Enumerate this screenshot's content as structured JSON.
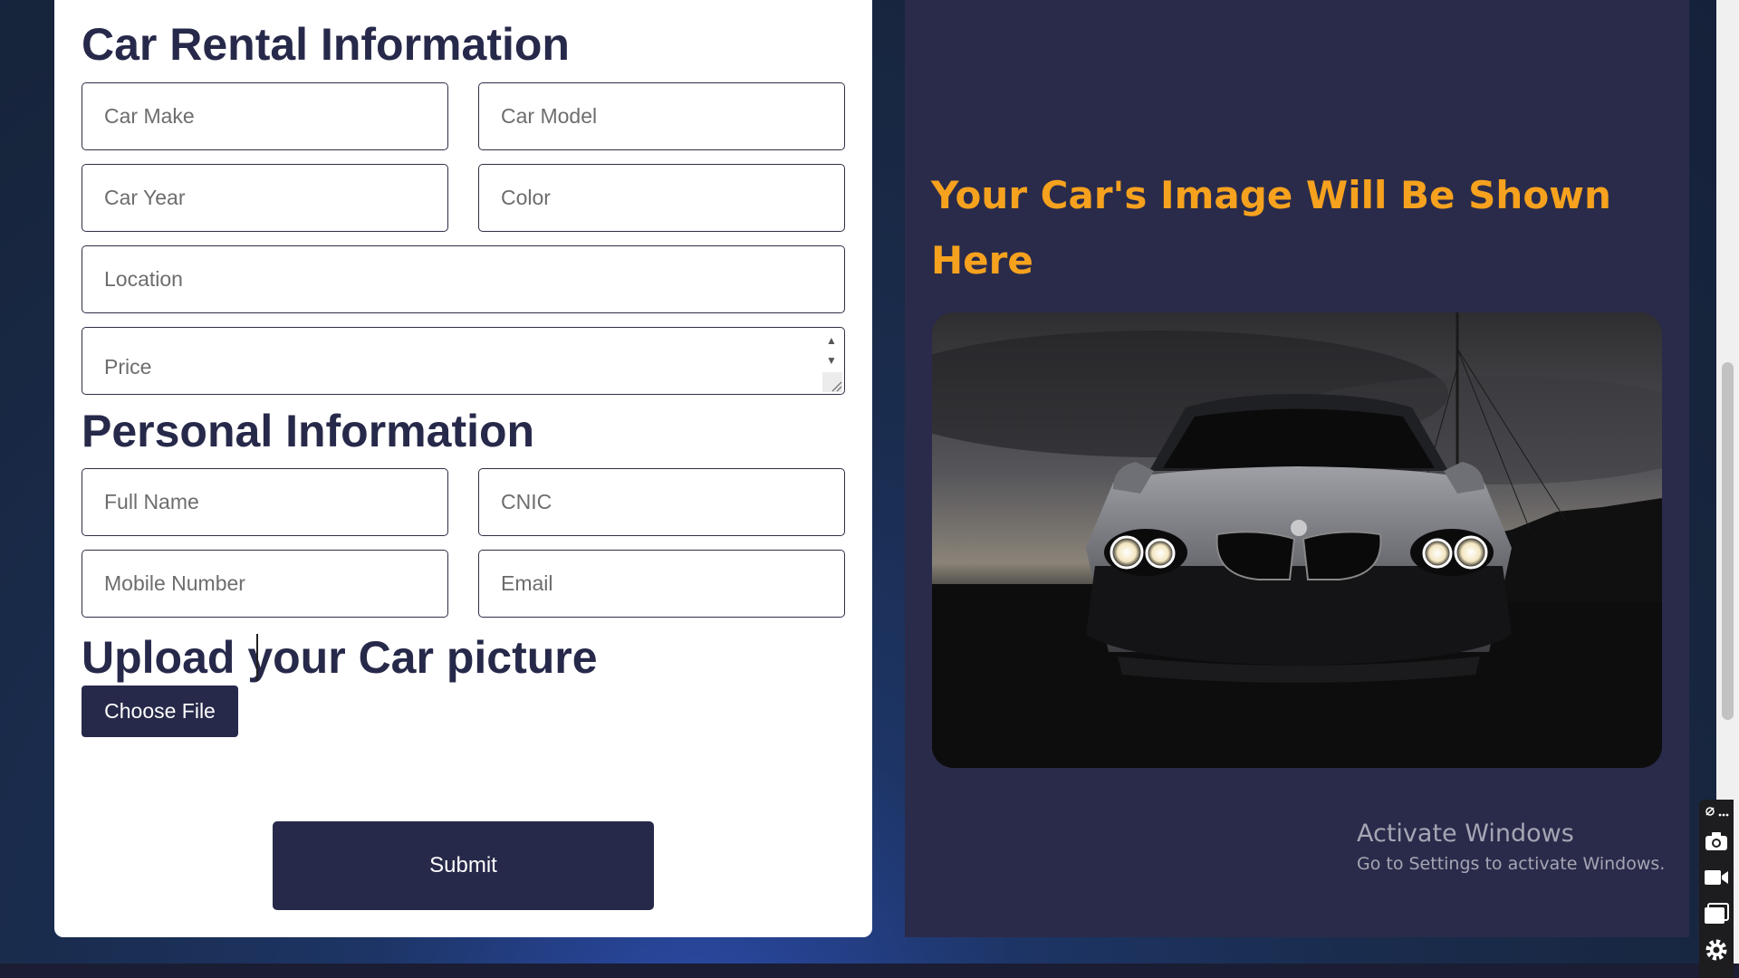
{
  "rental": {
    "title": "Car Rental Information",
    "car_make_placeholder": "Car Make",
    "car_model_placeholder": "Car Model",
    "car_year_placeholder": "Car Year",
    "color_placeholder": "Color",
    "location_placeholder": "Location",
    "price_placeholder": "Price"
  },
  "personal": {
    "title": "Personal Information",
    "full_name_placeholder": "Full Name",
    "cnic_placeholder": "CNIC",
    "mobile_placeholder": "Mobile Number",
    "email_placeholder": "Email"
  },
  "upload": {
    "title": "Upload your Car picture",
    "choose_file_label": "Choose File"
  },
  "submit_label": "Submit",
  "preview": {
    "title": "Your Car's Image Will Be Shown Here"
  },
  "watermark": {
    "title": "Activate Windows",
    "subtitle": "Go to Settings to activate Windows."
  },
  "toolbar": {
    "icons": [
      "pin-icon",
      "more-icon",
      "camera-icon",
      "video-icon",
      "window-icon",
      "gear-icon"
    ]
  },
  "colors": {
    "accent": "#f6a21e",
    "primary": "#27294a",
    "preview_bg": "#2a2b4a"
  }
}
